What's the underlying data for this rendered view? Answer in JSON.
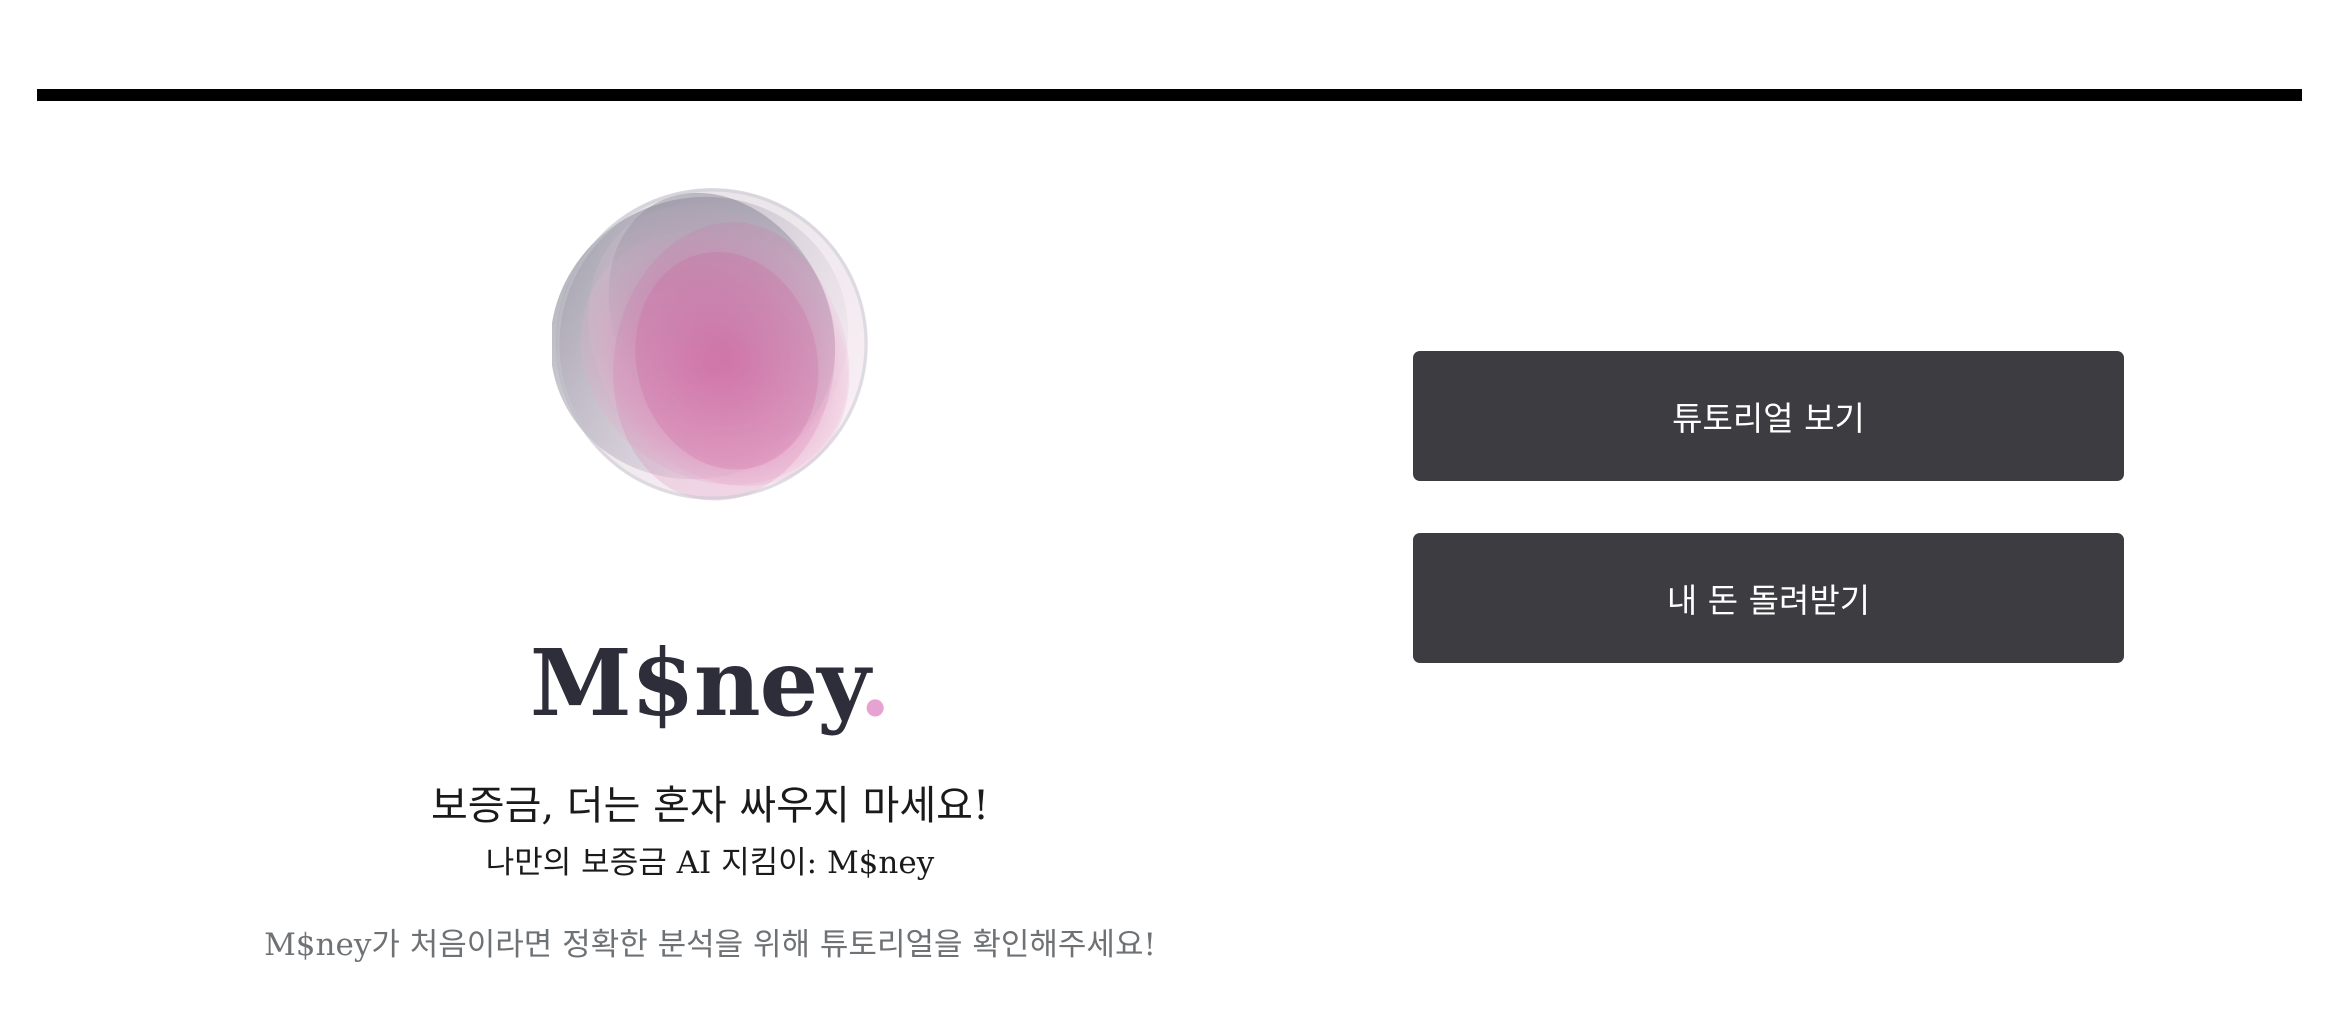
{
  "brand": {
    "name": "M$ney",
    "dot": ".",
    "accent_color": "#e6a3d2",
    "text_color": "#2e2e3a"
  },
  "hero": {
    "headline": "보증금, 더는 혼자 싸우지 마세요!",
    "subline": "나만의 보증금 AI 지킴이: M$ney",
    "hint": "M$ney가 처음이라면 정확한 분석을 위해 튜토리얼을 확인해주세요!"
  },
  "actions": {
    "tutorial_label": "튜토리얼 보기",
    "refund_label": "내 돈 돌려받기",
    "button_color": "#3d3c41"
  },
  "icons": {
    "logo": "gradient-orb-icon"
  }
}
